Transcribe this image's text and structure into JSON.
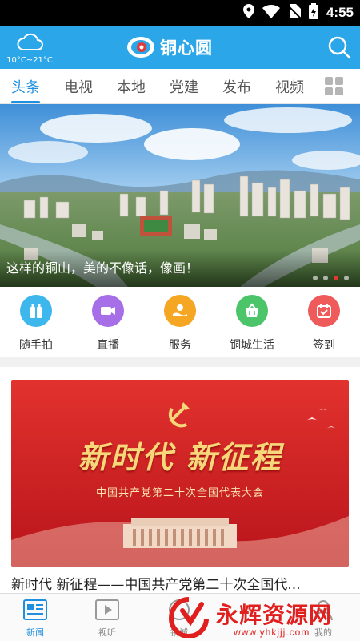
{
  "status_bar": {
    "time": "4:55"
  },
  "header": {
    "weather_temp": "10°C~21°C",
    "app_name": "铜心圆"
  },
  "tabs": [
    {
      "label": "头条",
      "active": true
    },
    {
      "label": "电视"
    },
    {
      "label": "本地"
    },
    {
      "label": "党建"
    },
    {
      "label": "发布"
    },
    {
      "label": "视频"
    }
  ],
  "banner": {
    "caption": "这样的铜山，美的不像话，像画！",
    "slide_count": 4,
    "active_slide": 3
  },
  "quick_actions": [
    {
      "label": "随手拍",
      "icon": "bottles-icon",
      "color": "#3db7ec"
    },
    {
      "label": "直播",
      "icon": "video-camera-icon",
      "color": "#a66fe8"
    },
    {
      "label": "服务",
      "icon": "service-hand-icon",
      "color": "#f5a623"
    },
    {
      "label": "铜城生活",
      "icon": "shopping-basket-icon",
      "color": "#4cc46a"
    },
    {
      "label": "签到",
      "icon": "checkin-calendar-icon",
      "color": "#ef5a5a"
    }
  ],
  "article": {
    "title": "新时代 新征程——中国共产党第二十次全国代...",
    "image_headline": "新时代  新征程",
    "image_subtitle": "中国共产党第二十次全国代表大会"
  },
  "bottom_nav": [
    {
      "label": "新闻",
      "active": true,
      "icon": "news-icon"
    },
    {
      "label": "视听",
      "icon": "play-icon"
    },
    {
      "label": "铜城",
      "icon": "city-icon"
    },
    {
      "label": "我的",
      "icon": "user-icon"
    }
  ],
  "watermark": {
    "text": "永辉资源网",
    "url": "www.yhkjjj.com"
  },
  "colors": {
    "brand_blue": "#2ba6e8",
    "tab_active": "#1f8fe0",
    "party_red": "#d8262a"
  }
}
